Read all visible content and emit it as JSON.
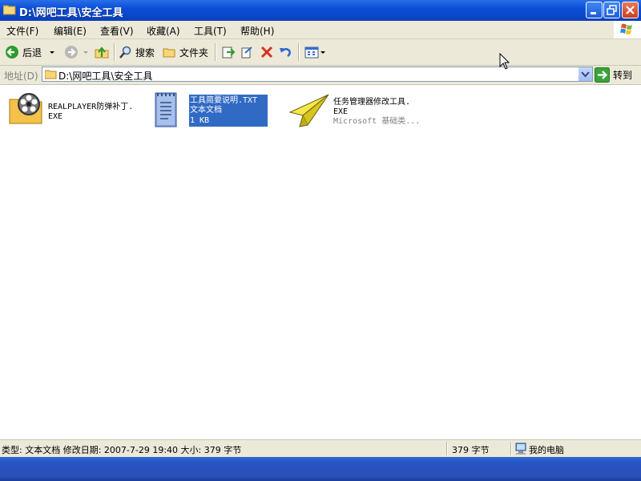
{
  "window": {
    "title": "D:\\网吧工具\\安全工具",
    "buttons": {
      "minimize": "minimize",
      "maximize": "maximize",
      "close": "close"
    }
  },
  "menu": [
    "文件(F)",
    "编辑(E)",
    "查看(V)",
    "收藏(A)",
    "工具(T)",
    "帮助(H)"
  ],
  "toolbar": {
    "back_label": "后退",
    "search_label": "搜索",
    "folders_label": "文件夹"
  },
  "address": {
    "label": "地址(D)",
    "path": "D:\\网吧工具\\安全工具",
    "go_label": "转到"
  },
  "files": [
    {
      "name": "REALPLAYER防弹补丁.",
      "type": "EXE",
      "icon": "realplayer-icon"
    },
    {
      "name": "工具简要说明.TXT",
      "type": "文本文档",
      "size": "1 KB",
      "icon": "text-document-icon",
      "selected": true
    },
    {
      "name": "任务管理器修改工具.",
      "type": "EXE",
      "desc": "Microsoft 基础类...",
      "icon": "paper-plane-icon"
    }
  ],
  "status": {
    "details": "类型: 文本文档 修改日期: 2007-7-29 19:40 大小: 379 字节",
    "size": "379 字节",
    "location": "我的电脑"
  },
  "colors": {
    "titlebar": "#0a4fd6",
    "selection": "#316ac5",
    "chrome": "#ece9d8",
    "taskbar": "#2a4fb8"
  }
}
